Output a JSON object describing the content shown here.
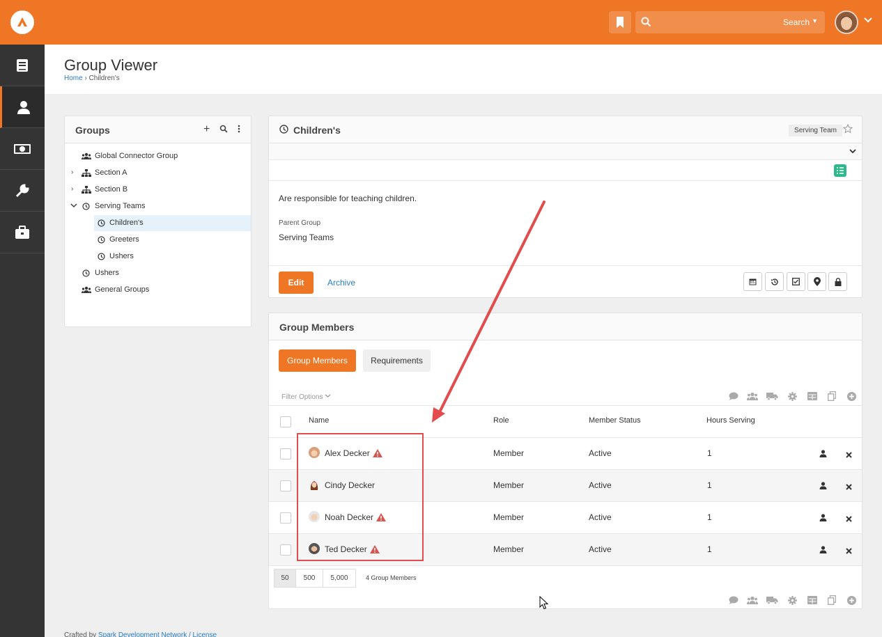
{
  "search": {
    "label": "Search",
    "placeholder": ""
  },
  "sidebar": {
    "items": [
      {
        "icon": "book-icon"
      },
      {
        "icon": "person-icon"
      },
      {
        "icon": "money-icon"
      },
      {
        "icon": "wrench-icon"
      },
      {
        "icon": "briefcase-icon"
      }
    ]
  },
  "header": {
    "title": "Group Viewer",
    "breadcrumb_home": "Home",
    "breadcrumb_current": "Children's"
  },
  "tree": {
    "title": "Groups",
    "items": [
      {
        "label": "Global Connector Group"
      },
      {
        "label": "Section A"
      },
      {
        "label": "Section B"
      },
      {
        "label": "Serving Teams"
      },
      {
        "label": "Children's"
      },
      {
        "label": "Greeters"
      },
      {
        "label": "Ushers"
      },
      {
        "label": "Ushers"
      },
      {
        "label": "General Groups"
      }
    ]
  },
  "group": {
    "name": "Children's",
    "type_tag": "Serving Team",
    "description": "Are responsible for teaching children.",
    "parent_label": "Parent Group",
    "parent_value": "Serving Teams",
    "edit_label": "Edit",
    "archive_label": "Archive"
  },
  "members": {
    "title": "Group Members",
    "tab_members": "Group Members",
    "tab_requirements": "Requirements",
    "filter_label": "Filter Options",
    "columns": {
      "name": "Name",
      "role": "Role",
      "status": "Member Status",
      "hours": "Hours Serving"
    },
    "rows": [
      {
        "name": "Alex Decker",
        "role": "Member",
        "status": "Active",
        "hours": "1",
        "warning": true
      },
      {
        "name": "Cindy Decker",
        "role": "Member",
        "status": "Active",
        "hours": "1",
        "warning": false
      },
      {
        "name": "Noah Decker",
        "role": "Member",
        "status": "Active",
        "hours": "1",
        "warning": true
      },
      {
        "name": "Ted Decker",
        "role": "Member",
        "status": "Active",
        "hours": "1",
        "warning": true
      }
    ],
    "pager": [
      "50",
      "500",
      "5,000"
    ],
    "count_label": "4 Group Members"
  },
  "footer": {
    "prefix": "Crafted by",
    "link": "Spark Development Network / License"
  },
  "colors": {
    "brand": "#ee7624",
    "link": "#2a7dc1",
    "warning": "#d9534f",
    "sidebar": "#343434"
  }
}
